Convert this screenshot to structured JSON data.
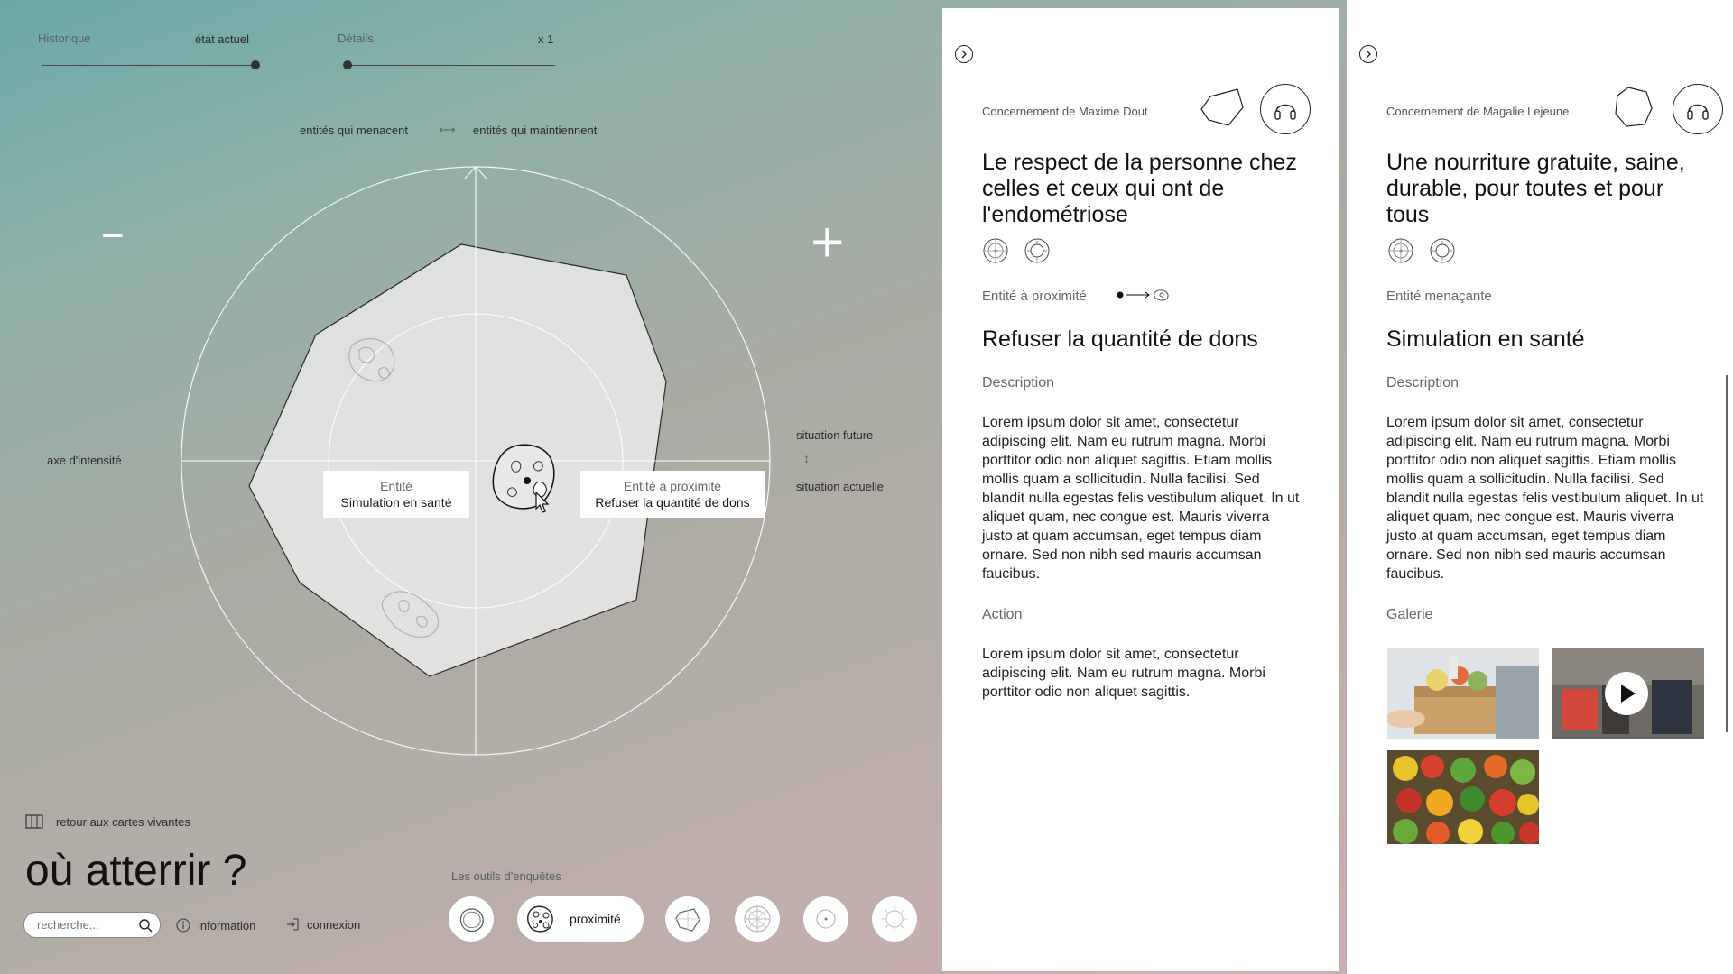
{
  "header": {
    "historique": "Historique",
    "etat_actuel": "état actuel",
    "details": "Détails",
    "zoom": "x 1"
  },
  "axis": {
    "menacent": "entités qui menacent",
    "arrow": "⟷",
    "maintiennent": "entités qui maintiennent",
    "intensite": "axe d'intensité",
    "future": "situation future",
    "actuelle": "situation actuelle",
    "minus": "−",
    "plus": "+"
  },
  "tooltips": {
    "entity_label": "Entité",
    "entity_value": "Simulation en santé",
    "prox_label": "Entité à proximité",
    "prox_value": "Refuser la quantité de dons"
  },
  "footer": {
    "retour": "retour aux cartes vivantes",
    "title": "où atterrir ?",
    "search_placeholder": "recherche...",
    "information": "information",
    "connexion": "connexion"
  },
  "tools": {
    "label": "Les outils d'enquêtes",
    "active_label": "proximité"
  },
  "panel1": {
    "concern": "Concernement de Maxime Dout",
    "title": "Le respect de la personne chez celles et ceux qui ont de l'endométriose",
    "entity_type": "Entité à proximité",
    "entity_name": "Refuser la quantité de dons",
    "desc_label": "Description",
    "desc": "Lorem ipsum dolor sit amet, consectetur adipiscing elit. Nam eu rutrum magna. Morbi porttitor odio non aliquet sagittis. Etiam mollis mollis quam a sollicitudin. Nulla facilisi. Sed blandit nulla egestas felis vestibulum aliquet. In ut aliquet quam, nec congue est. Mauris viverra justo at quam accumsan, eget tempus diam ornare. Sed non nibh sed mauris accumsan faucibus.",
    "action_label": "Action",
    "action": "Lorem ipsum dolor sit amet, consectetur adipiscing elit. Nam eu rutrum magna. Morbi porttitor odio non aliquet sagittis."
  },
  "panel2": {
    "concern": "Concernement de Magalie Lejeune",
    "title": "Une nourriture gratuite, saine, durable, pour toutes et pour tous",
    "entity_type": "Entité menaçante",
    "entity_name": "Simulation en santé",
    "desc_label": "Description",
    "desc": "Lorem ipsum dolor sit amet, consectetur adipiscing elit. Nam eu rutrum magna. Morbi porttitor odio non aliquet sagittis. Etiam mollis mollis quam a sollicitudin. Nulla facilisi. Sed blandit nulla egestas felis vestibulum aliquet. In ut aliquet quam, nec congue est. Mauris viverra justo at quam accumsan, eget tempus diam ornare. Sed non nibh sed mauris accumsan faucibus.",
    "gallery_label": "Galerie"
  }
}
